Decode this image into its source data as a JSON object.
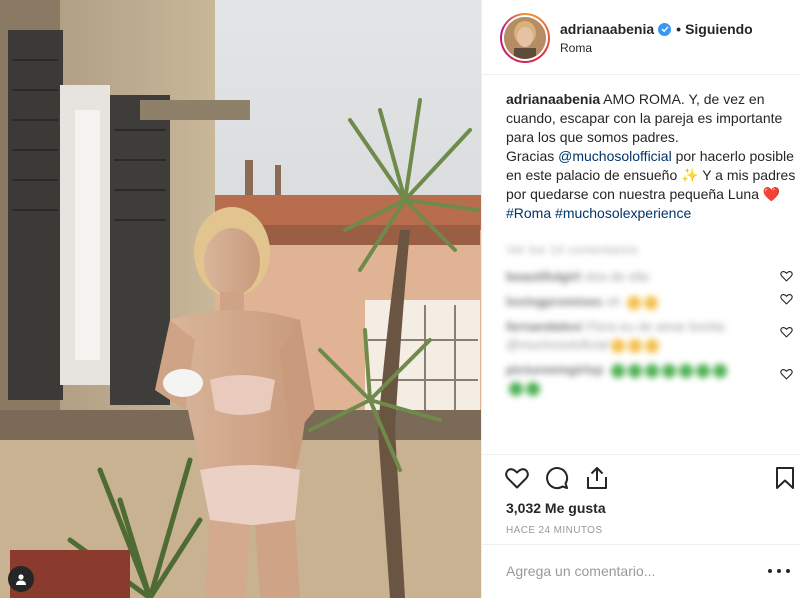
{
  "header": {
    "username": "adrianaabenia",
    "separator": "•",
    "follow_status": "Siguiendo",
    "location": "Roma"
  },
  "caption": {
    "username": "adrianaabenia",
    "text_1": "AMO ROMA. Y, de vez en cuando, escapar con la pareja es importante para los que somos padres.",
    "text_2": "Gracias ",
    "mention": "@muchosolofficial",
    "text_3": " por hacerlo posible en este palacio de ensueño ✨ Y a mis padres por quedarse con nuestra pequeña Luna ",
    "heart_emoji": "❤️",
    "hashtag_1": "#Roma",
    "hashtag_2": "#muchosolexperience"
  },
  "comments": {
    "view_more": "Ver los 14 comentarios",
    "items": [
      {
        "user": "beautifulgirl",
        "text": "otra de ella"
      },
      {
        "user": "lovingpromises",
        "text": "oh "
      },
      {
        "user": "fernandalevi",
        "text": "Flora eu de amar bonita @muchosoloficial"
      },
      {
        "user": "pictureemgirlsp",
        "text": ""
      }
    ]
  },
  "actions": {
    "likes": "3,032 Me gusta",
    "timestamp": "HACE 24 MINUTOS"
  },
  "add_comment": {
    "placeholder": "Agrega un comentario..."
  },
  "colors": {
    "link": "#003569",
    "verified": "#3897f0",
    "heart": "#ed4956",
    "text": "#262626",
    "muted": "#999999"
  },
  "icons": {
    "like": "heart-outline-icon",
    "comment": "speech-bubble-icon",
    "share": "share-icon",
    "save": "bookmark-icon",
    "verified": "verified-badge-icon",
    "tags": "user-tag-icon",
    "more": "ellipsis-icon"
  }
}
